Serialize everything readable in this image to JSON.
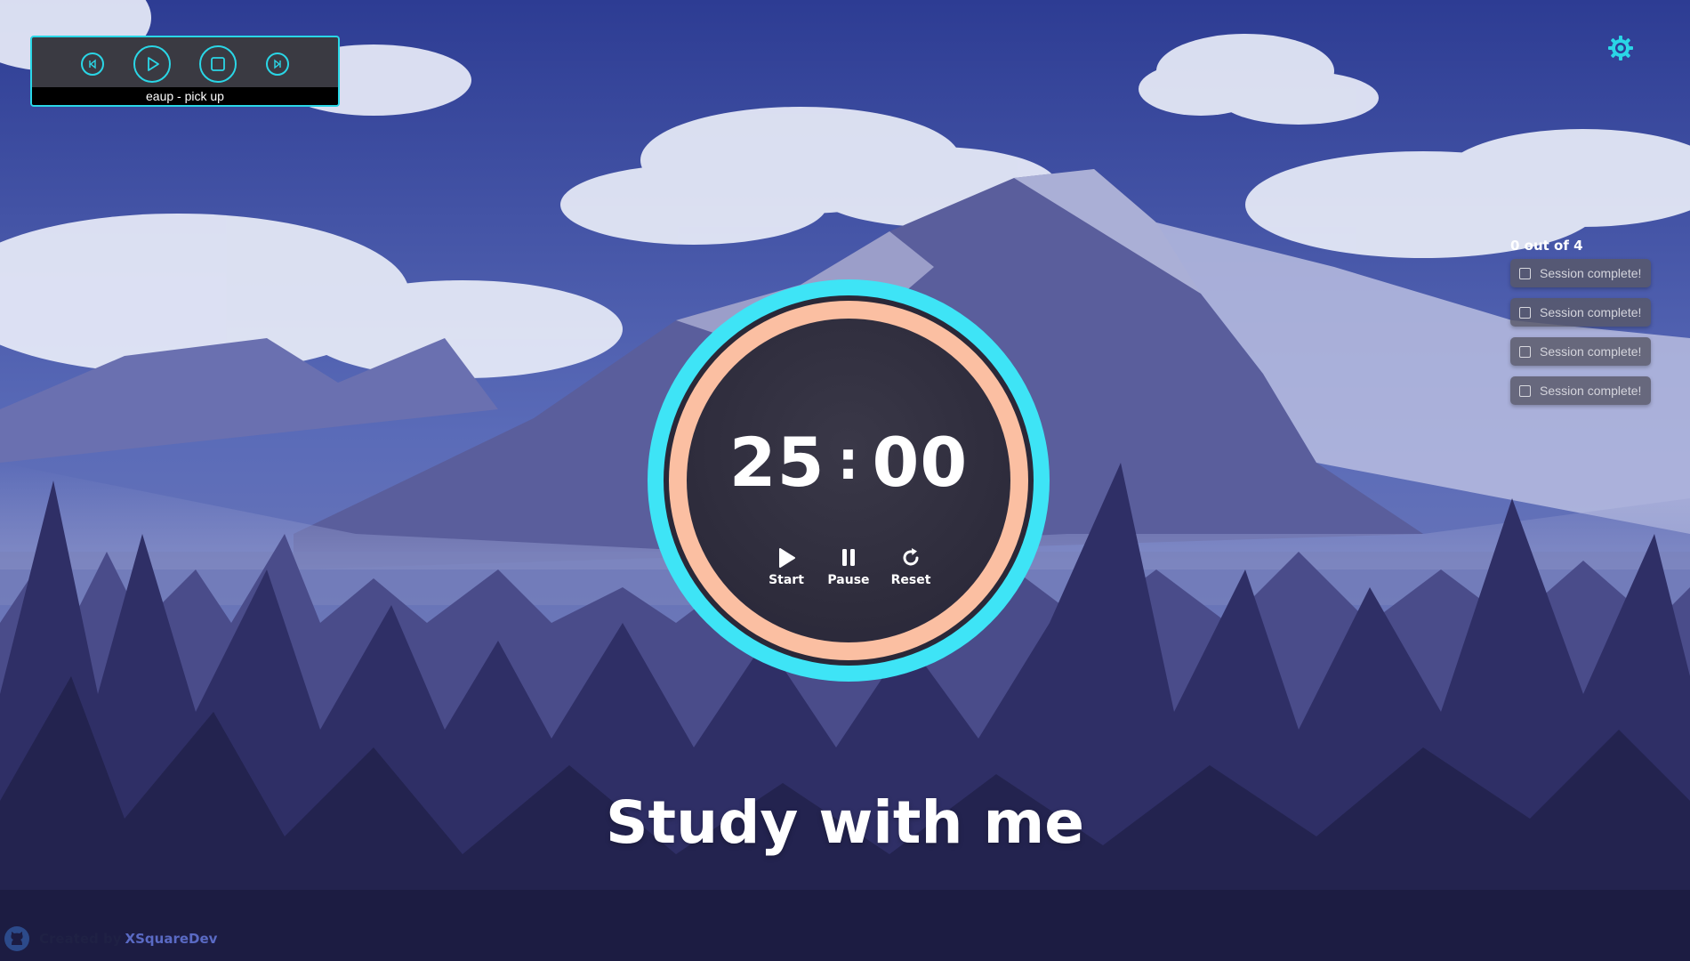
{
  "colors": {
    "accent_cyan": "#3ee4f6",
    "ring_peach": "#fbbfa2",
    "sky_top": "#2f3f9a",
    "forest_dark": "#1e1e4a"
  },
  "player": {
    "track_name": "eaup - pick up",
    "icons": [
      "skip-back-icon",
      "play-icon",
      "stop-icon",
      "skip-forward-icon"
    ]
  },
  "settings": {
    "icon": "gear-icon"
  },
  "sessions": {
    "count_text": "0 out of 4",
    "items": [
      {
        "label": "Session complete!"
      },
      {
        "label": "Session complete!"
      },
      {
        "label": "Session complete!"
      },
      {
        "label": "Session complete!"
      }
    ]
  },
  "timer": {
    "minutes": "25",
    "separator": ":",
    "seconds": "00",
    "start_label": "Start",
    "pause_label": "Pause",
    "reset_label": "Reset"
  },
  "headline": "Study with me",
  "footer": {
    "prefix": "Created by",
    "author": "XSquareDev",
    "icon": "github-icon"
  }
}
